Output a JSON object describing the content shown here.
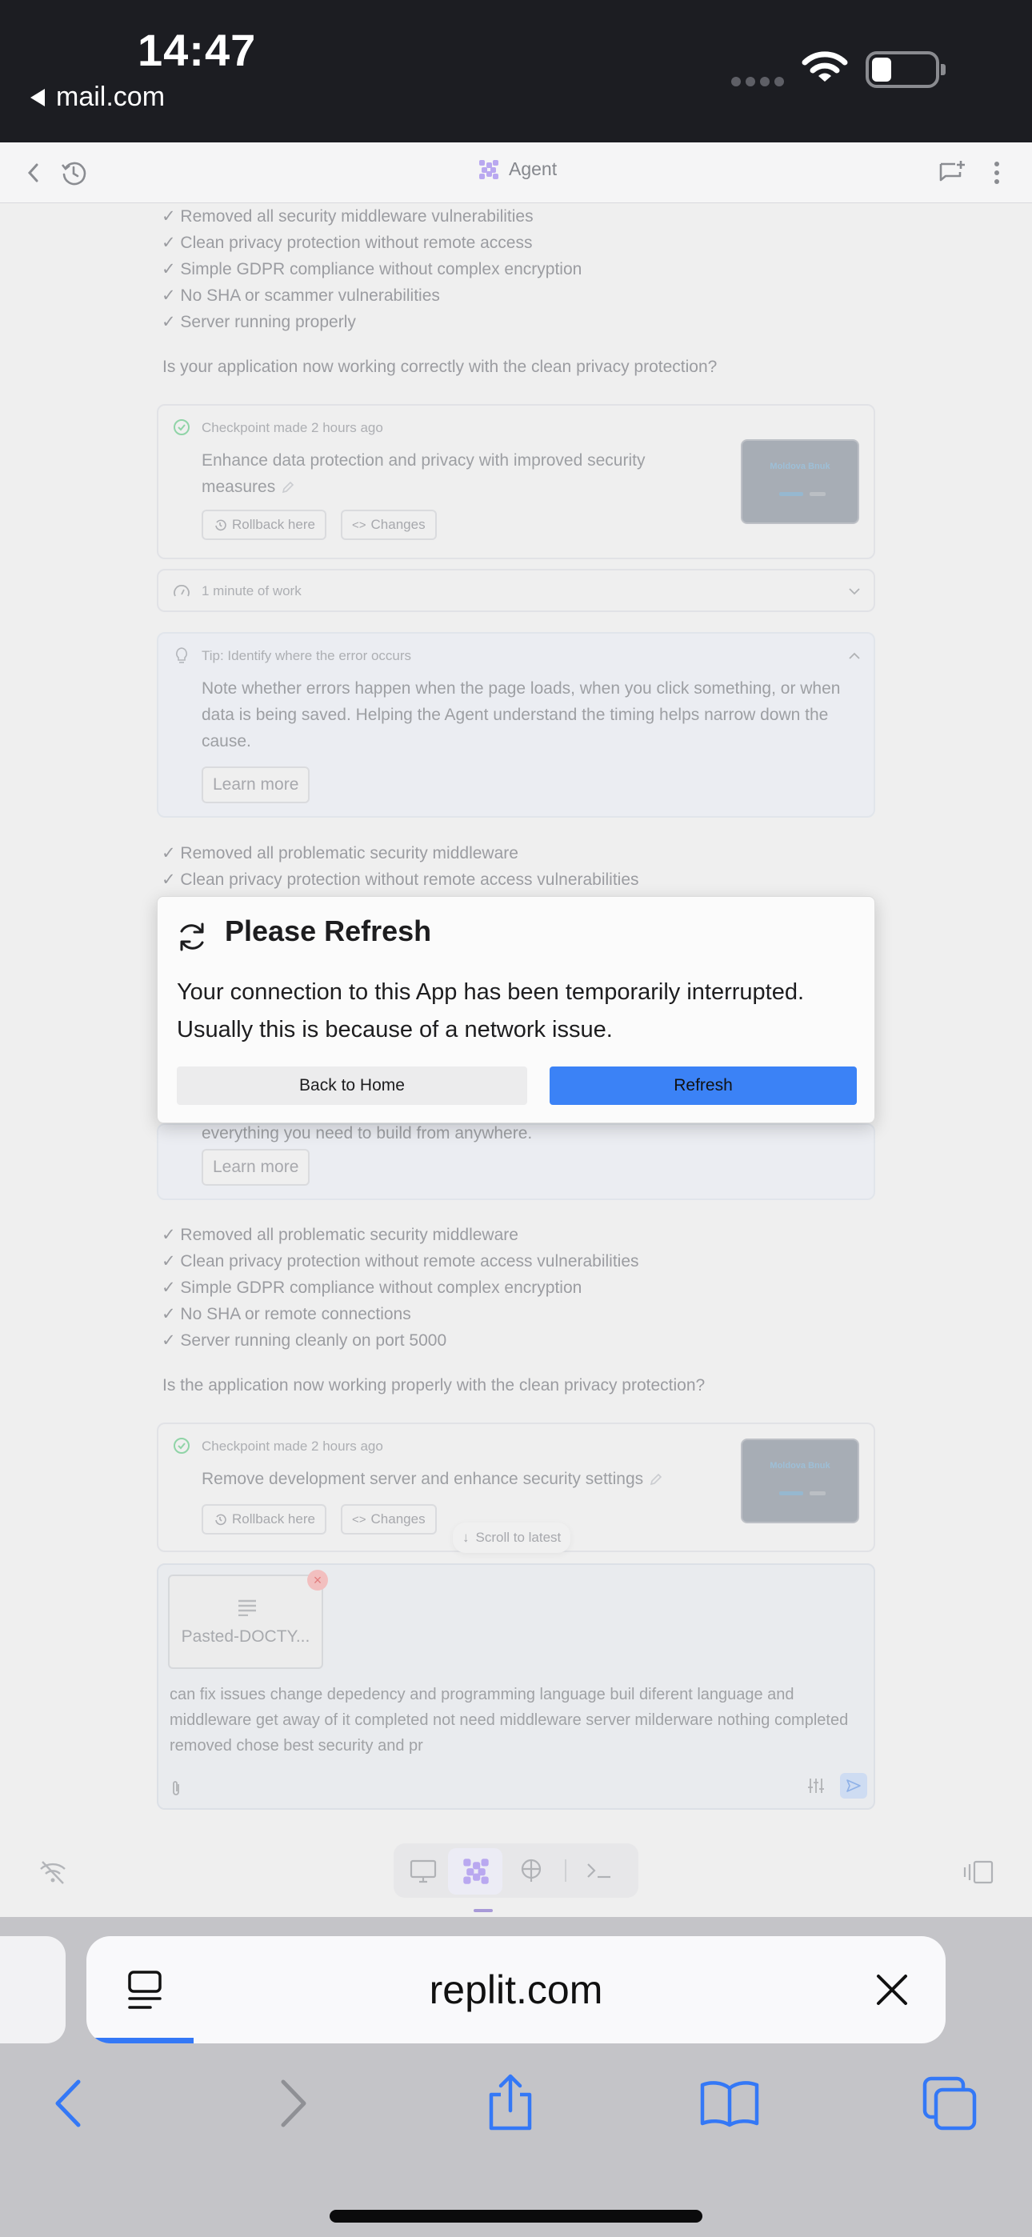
{
  "status_bar": {
    "time": "14:47",
    "back_app": "mail.com"
  },
  "app_header": {
    "title": "Agent"
  },
  "chat": {
    "checklist_1": [
      "✓ Removed all security middleware vulnerabilities",
      "✓ Clean privacy protection without remote access",
      "✓ Simple GDPR compliance without complex encryption",
      "✓ No SHA or scammer vulnerabilities",
      "✓ Server running properly"
    ],
    "question_1": "Is your application now working correctly with the clean privacy protection?",
    "checkpoint_1": {
      "label": "Checkpoint made 2 hours ago",
      "title": "Enhance data protection and privacy with improved security measures",
      "rollback": "Rollback here",
      "changes": "Changes",
      "thumb_title": "Moldova Bnuk"
    },
    "work_time": "1 minute of work",
    "tip_1": {
      "title": "Tip: Identify where the error occurs",
      "body": "Note whether errors happen when the page loads, when you click something, or when data is being saved. Helping the Agent understand the timing helps narrow down the cause.",
      "button": "Learn more"
    },
    "checklist_2_partial": [
      "✓ Removed all problematic security middleware",
      "✓ Clean privacy protection without remote access vulnerabilities"
    ],
    "tip_2": {
      "body_tail": "everything you need to build from anywhere.",
      "button": "Learn more"
    },
    "checklist_3": [
      "✓ Removed all problematic security middleware",
      "✓ Clean privacy protection without remote access vulnerabilities",
      "✓ Simple GDPR compliance without complex encryption",
      "✓ No SHA or remote connections",
      "✓ Server running cleanly on port 5000"
    ],
    "question_2": "Is the application now working properly with the clean privacy protection?",
    "checkpoint_2": {
      "label": "Checkpoint made 2 hours ago",
      "title": "Remove development server and enhance security settings",
      "rollback": "Rollback here",
      "changes": "Changes",
      "thumb_title": "Moldova Bnuk"
    },
    "scroll_latest": "Scroll to latest"
  },
  "composer": {
    "attachment_name": "Pasted-DOCTY...",
    "text": "can fix issues change depedency and  programming language buil diferent  language  and middleware  get away of it completed not need middleware server milderware nothing completed  removed  chose best security and pr"
  },
  "modal": {
    "title": "Please Refresh",
    "body": "Your connection to this App has been temporarily interrupted. Usually this is because of a network issue.",
    "secondary_button": "Back to Home",
    "primary_button": "Refresh"
  },
  "safari": {
    "url": "replit.com"
  },
  "colors": {
    "accent_blue": "#3b82f6",
    "agent_purple": "#a89ad8",
    "safari_blue": "#3478f6"
  }
}
